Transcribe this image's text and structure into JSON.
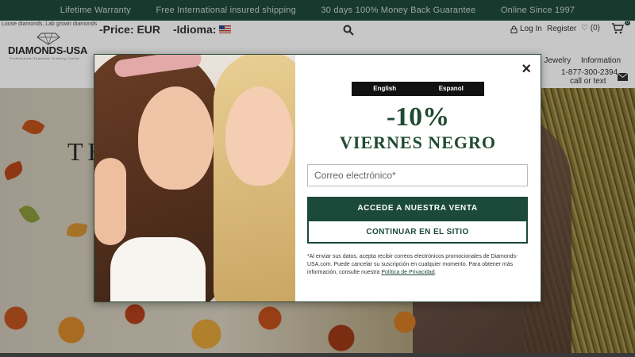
{
  "topbar": {
    "items": [
      "Lifetime Warranty",
      "Free International insured shipping",
      "30 days 100% Money Back Guarantee",
      "Online Since 1997"
    ]
  },
  "header": {
    "tagline": "Loose diamonds, Lab grown diamonds",
    "logo_text": "DIAMONDS-USA",
    "logo_sub": "Professional Diamond Grading Center",
    "price_label": "-Price: EUR",
    "language_label": "-Idioma:",
    "login_label": "Log In",
    "register_label": "Register",
    "wishlist_label": "(0)",
    "cart_count": "0",
    "nav_jewelry": "e Jewelry",
    "nav_information": "Information",
    "phone": "1-877-300-2394",
    "call_text": "call or text"
  },
  "hero": {
    "title_fragment": "TH"
  },
  "modal": {
    "lang_tabs": [
      "English",
      "Espanol"
    ],
    "discount": "-10%",
    "sale_name": "VIERNES NEGRO",
    "email_placeholder": "Correo electrónico*",
    "primary_button": "ACCEDE A NUESTRA VENTA",
    "secondary_button": "CONTINUAR EN EL SITIO",
    "disclaimer": "*Al enviar sus datos, acepta recibir correos electrónicos promocionales de Diamonds-USA.com. Puede cancelar su suscripción en cualquier momento. Para obtener más información, consulte nuestra ",
    "privacy_link": "Política de Privacidad",
    "disclaimer_end": ".",
    "close_symbol": "×"
  },
  "colors": {
    "brand_green": "#1b4a3a",
    "topbar_bg": "#1f4a3c",
    "headline_green": "#1f4a32"
  }
}
